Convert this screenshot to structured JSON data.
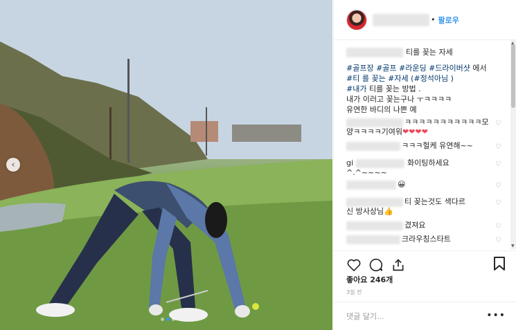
{
  "header": {
    "follow_label": "팔로우",
    "separator": "•"
  },
  "caption": {
    "lines": [
      [
        "",
        "티를 꽂는 자세"
      ],
      [
        "#골프장 #골프 #라운딩 #드라이버샷",
        " 에서"
      ],
      [
        "#티 를 꽂는 #자세 (#정석아님 )",
        ""
      ],
      [
        "#내가",
        " 티를 꽂는 방법 ."
      ],
      [
        "",
        "내가 이러고 꽂는구나 ㅜㅋㅋㅋㅋ"
      ],
      [
        "",
        "유연한 바디의 나쁜 예"
      ]
    ]
  },
  "comments": [
    {
      "prefix": "",
      "text": "ㅋㅋㅋㅋㅋㅋㅋㅋㅋㅋㅋ모"
    },
    {
      "prefix": "",
      "text": "양ㅋㅋㅋㅋ기여워",
      "hearts": "❤❤❤❤"
    },
    {
      "prefix": "",
      "text": "ㅋㅋㅋ헐케 유연해~~"
    },
    {
      "prefix": "gi",
      "text": "화이팅하세요"
    },
    {
      "prefix": "",
      "text": "^.^~~~~"
    },
    {
      "prefix": "",
      "text": "😀"
    },
    {
      "prefix": "",
      "text": "티 꽂는것도 색다르"
    },
    {
      "prefix": "",
      "text": "신 방사상님👍"
    },
    {
      "prefix": "",
      "text": "겼져요"
    },
    {
      "prefix": "",
      "text": "크라우칭스타트"
    }
  ],
  "icons": {
    "heart": "heart-icon",
    "comment": "comment-icon",
    "share": "share-icon",
    "save": "bookmark-icon",
    "more": "more-options-icon",
    "nav": "chevron-left-icon"
  },
  "likes": "좋아요 246개",
  "time": "3일 전",
  "add_comment_placeholder": "댓글 달기...",
  "more_label": "•••",
  "nav_arrow": "‹",
  "colors": {
    "link": "#3897f0",
    "hashtag": "#003569",
    "heart_red": "#ed4956"
  }
}
